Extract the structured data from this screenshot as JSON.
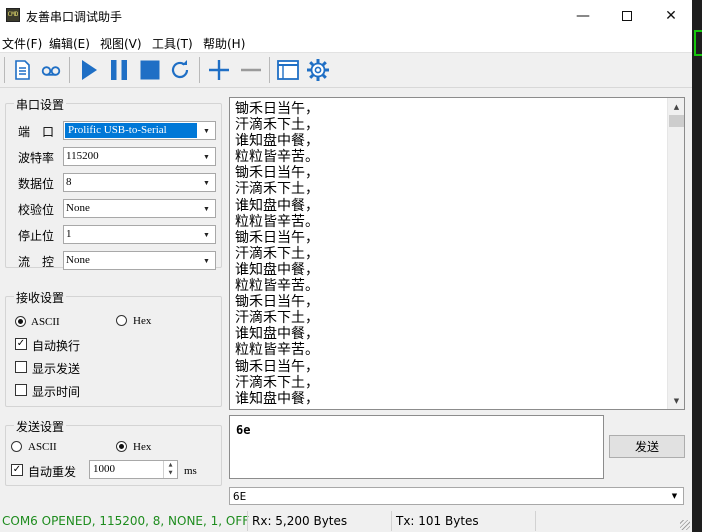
{
  "window": {
    "title": "友善串口调试助手",
    "app_icon_text": "CMD",
    "min_glyph": "—",
    "close_glyph": "✕"
  },
  "menu": [
    "文件(F)",
    "编辑(E)",
    "视图(V)",
    "工具(T)",
    "帮助(H)"
  ],
  "toolbar": {
    "buttons": [
      "new-file-icon",
      "loop-icon",
      "play-icon",
      "pause-icon",
      "stop-icon",
      "refresh-icon",
      "add-icon",
      "remove-icon",
      "window-icon",
      "gear-icon"
    ],
    "accent": "#1f6fc5"
  },
  "serial_settings": {
    "title": "串口设置",
    "rows": [
      {
        "label": "端　口",
        "value": "Prolific USB-to-Serial"
      },
      {
        "label": "波特率",
        "value": "115200"
      },
      {
        "label": "数据位",
        "value": "8"
      },
      {
        "label": "校验位",
        "value": "None"
      },
      {
        "label": "停止位",
        "value": "1"
      },
      {
        "label": "流　控",
        "value": "None"
      }
    ]
  },
  "receive_settings": {
    "title": "接收设置",
    "ascii": "ASCII",
    "hex": "Hex",
    "auto_newline": "自动换行",
    "show_send": "显示发送",
    "show_time": "显示时间"
  },
  "send_settings": {
    "title": "发送设置",
    "ascii": "ASCII",
    "hex": "Hex",
    "auto_resend": "自动重发",
    "interval": "1000",
    "unit": "ms"
  },
  "receive_lines": [
    "锄禾日当午，",
    "汗滴禾下土，",
    "谁知盘中餐，",
    "粒粒皆辛苦。",
    "锄禾日当午，",
    "汗滴禾下土，",
    "谁知盘中餐，",
    "粒粒皆辛苦。",
    "锄禾日当午，",
    "汗滴禾下土，",
    "谁知盘中餐，",
    "粒粒皆辛苦。",
    "锄禾日当午，",
    "汗滴禾下土，",
    "谁知盘中餐，",
    "粒粒皆辛苦。",
    "锄禾日当午，",
    "汗滴禾下土，",
    "谁知盘中餐，"
  ],
  "send": {
    "text": "6e",
    "button_label": "发送",
    "history_value": "6E"
  },
  "status": {
    "connection": "COM6 OPENED, 115200, 8, NONE, 1, OFF",
    "rx": "Rx: 5,200 Bytes",
    "tx": "Tx: 101 Bytes",
    "connection_color": "#1e8c1e"
  }
}
